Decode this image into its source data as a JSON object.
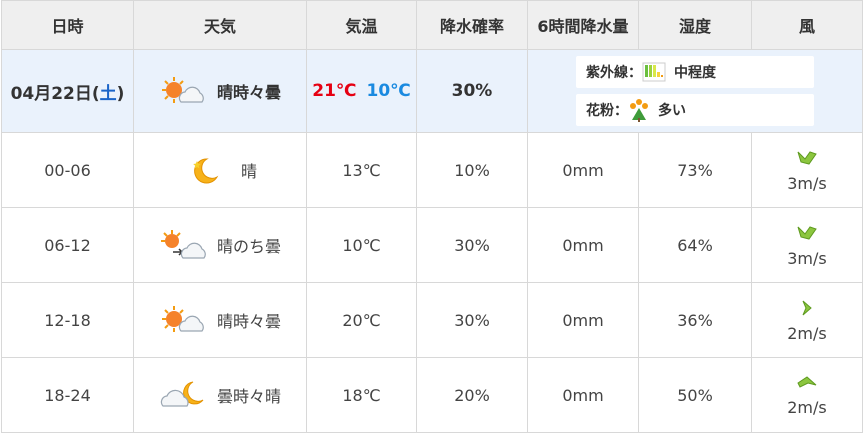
{
  "headers": [
    "日時",
    "天気",
    "気温",
    "降水確率",
    "6時間降水量",
    "湿度",
    "風"
  ],
  "day": {
    "date": "04月22日(",
    "dow": "土",
    "date_close": ")",
    "weather": "晴時々曇",
    "weather_icon": "sun-cloud-icon",
    "temp_max": "21℃",
    "temp_min": "10℃",
    "pop": "30%",
    "uv_label": "紫外線：",
    "uv_value": "中程度",
    "pollen_label": "花粉：",
    "pollen_value": "多い"
  },
  "rows": [
    {
      "time": "00-06",
      "weather": "晴",
      "icon": "moon-icon",
      "temp": "13℃",
      "pop": "10%",
      "rain": "0mm",
      "humidity": "73%",
      "wind": "3m/s",
      "wind_icon": "wind-arrow-southwest-icon"
    },
    {
      "time": "06-12",
      "weather": "晴のち曇",
      "icon": "sun-then-cloud-icon",
      "temp": "10℃",
      "pop": "30%",
      "rain": "0mm",
      "humidity": "64%",
      "wind": "3m/s",
      "wind_icon": "wind-arrow-southwest-icon"
    },
    {
      "time": "12-18",
      "weather": "晴時々曇",
      "icon": "sun-cloud-icon",
      "temp": "20℃",
      "pop": "30%",
      "rain": "0mm",
      "humidity": "36%",
      "wind": "2m/s",
      "wind_icon": "wind-arrow-west-icon"
    },
    {
      "time": "18-24",
      "weather": "曇時々晴",
      "icon": "cloud-moon-icon",
      "temp": "18℃",
      "pop": "20%",
      "rain": "0mm",
      "humidity": "50%",
      "wind": "2m/s",
      "wind_icon": "wind-arrow-north-icon"
    }
  ],
  "colors": {
    "tmax": "#e60012",
    "tmin": "#1a8ae0",
    "dow": "#1a64c8",
    "wind": "#8cc63f"
  }
}
